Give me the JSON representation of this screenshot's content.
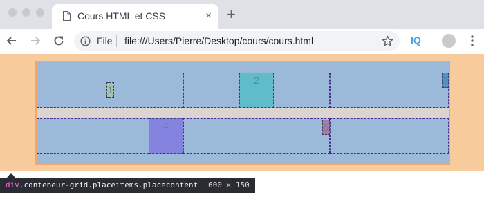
{
  "browser": {
    "tab": {
      "title": "Cours HTML et CSS",
      "close_glyph": "×"
    },
    "new_tab_glyph": "+",
    "omnibox": {
      "scheme": "File",
      "url": "file:///Users/Pierre/Desktop/cours/cours.html"
    },
    "extension_label": "IQ"
  },
  "grid": {
    "items": [
      {
        "label": "1",
        "color": "#a3c4a6"
      },
      {
        "label": "2",
        "color": "#5fbccb"
      },
      {
        "label": "3",
        "color": "#4f94c9"
      },
      {
        "label": "4",
        "color": "#8583e0"
      },
      {
        "label": "5",
        "color": "#a87ba0"
      }
    ]
  },
  "inspector_tooltip": {
    "tag": "div",
    "classes": ".conteneur-grid.placeitems.placecontent",
    "dimensions": "600 × 150"
  },
  "colors": {
    "body_highlight": "#f8cb9c",
    "grid_background": "#dcd3d3",
    "grid_track": "#9bbad9",
    "grid_border": "#f3a667"
  }
}
